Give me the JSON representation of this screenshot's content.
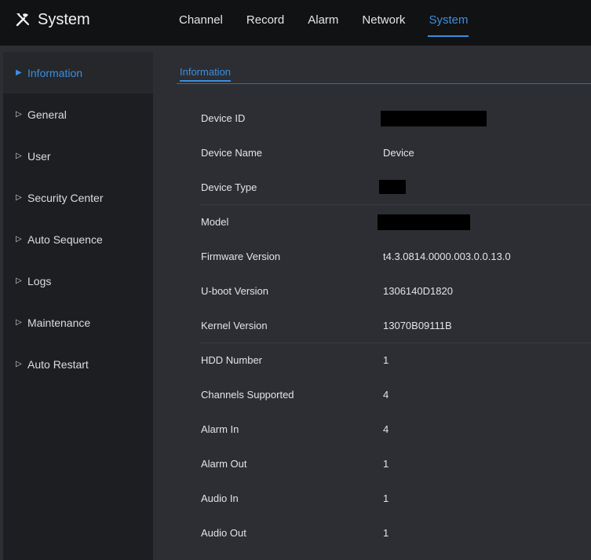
{
  "app": {
    "title": "System",
    "icon": "tools-icon"
  },
  "nav": {
    "tabs": [
      {
        "label": "Channel",
        "active": false
      },
      {
        "label": "Record",
        "active": false
      },
      {
        "label": "Alarm",
        "active": false
      },
      {
        "label": "Network",
        "active": false
      },
      {
        "label": "System",
        "active": true
      }
    ]
  },
  "sidebar": {
    "items": [
      {
        "label": "Information",
        "active": true
      },
      {
        "label": "General",
        "active": false
      },
      {
        "label": "User",
        "active": false
      },
      {
        "label": "Security Center",
        "active": false
      },
      {
        "label": "Auto Sequence",
        "active": false
      },
      {
        "label": "Logs",
        "active": false
      },
      {
        "label": "Maintenance",
        "active": false
      },
      {
        "label": "Auto Restart",
        "active": false
      }
    ]
  },
  "main": {
    "subtab": "Information",
    "rows": [
      {
        "label": "Device ID",
        "value": "",
        "redacted": true
      },
      {
        "label": "Device Name",
        "value": "Device",
        "redacted": false
      },
      {
        "label": "Device Type",
        "value": "",
        "redacted": true
      },
      {
        "label": "Model",
        "value": "",
        "redacted": true
      },
      {
        "label": "Firmware Version",
        "value": "t4.3.0814.0000.003.0.0.13.0",
        "redacted": false
      },
      {
        "label": "U-boot Version",
        "value": "1306140D1820",
        "redacted": false
      },
      {
        "label": "Kernel Version",
        "value": "13070B09111B",
        "redacted": false
      },
      {
        "label": "HDD Number",
        "value": "1",
        "redacted": false
      },
      {
        "label": "Channels Supported",
        "value": "4",
        "redacted": false
      },
      {
        "label": "Alarm In",
        "value": "4",
        "redacted": false
      },
      {
        "label": "Alarm Out",
        "value": "1",
        "redacted": false
      },
      {
        "label": "Audio In",
        "value": "1",
        "redacted": false
      },
      {
        "label": "Audio Out",
        "value": "1",
        "redacted": false
      }
    ]
  },
  "colors": {
    "accent": "#3a8fe0",
    "topbar": "#111214",
    "sidebar": "#1d1e21",
    "panel": "#2c2e33"
  }
}
